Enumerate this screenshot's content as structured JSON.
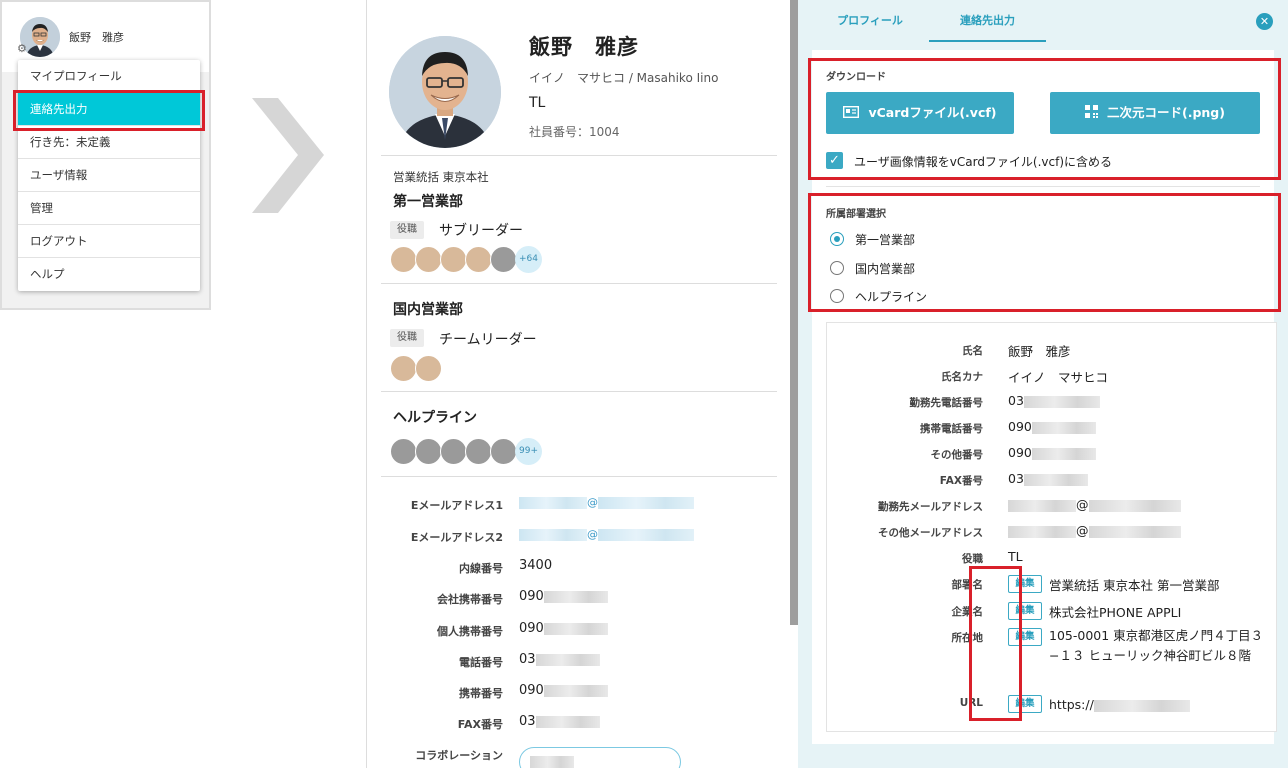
{
  "user_menu": {
    "header_name": "飯野　雅彦",
    "items": [
      {
        "label": "マイプロフィール"
      },
      {
        "label": "連絡先出力"
      },
      {
        "label": "行き先：未定義"
      },
      {
        "label": "ユーザ情報"
      },
      {
        "label": "管理"
      },
      {
        "label": "ログアウト"
      },
      {
        "label": "ヘルプ"
      }
    ],
    "active_item": "連絡先出力"
  },
  "profile": {
    "name": "飯野　雅彦",
    "kana": "イイノ　マサヒコ / Masahiko Iino",
    "title": "TL",
    "employee_no": "社員番号：1004",
    "dept_path": "営業統括 東京本社",
    "departments": [
      {
        "name": "第一営業部",
        "role_badge": "役職",
        "role": "サブリーダー",
        "more_count": "+64"
      },
      {
        "name": "国内営業部",
        "role_badge": "役職",
        "role": "チームリーダー",
        "more_count": ""
      },
      {
        "name": "ヘルプライン",
        "role_badge": "",
        "role": "",
        "more_count": "99+"
      }
    ],
    "contacts": [
      {
        "label": "Eメールアドレス1",
        "value": "@"
      },
      {
        "label": "Eメールアドレス2",
        "value": "@"
      },
      {
        "label": "内線番号",
        "value": "3400"
      },
      {
        "label": "会社携帯番号",
        "value": "090"
      },
      {
        "label": "個人携帯番号",
        "value": "090"
      },
      {
        "label": "電話番号",
        "value": "03"
      },
      {
        "label": "携帯番号",
        "value": "090"
      },
      {
        "label": "FAX番号",
        "value": "03"
      },
      {
        "label": "コラボレーション",
        "value": ""
      }
    ]
  },
  "export": {
    "tabs": [
      {
        "label": "プロフィール"
      },
      {
        "label": "連絡先出力"
      }
    ],
    "active_tab": "連絡先出力",
    "close_icon": "close-icon",
    "download": {
      "title": "ダウンロード",
      "vcard_button": "vCardファイル(.vcf)",
      "qr_button": "二次元コード(.png)",
      "include_image_label": "ユーザ画像情報をvCardファイル(.vcf)に含める",
      "include_image_checked": true
    },
    "dept_select": {
      "title": "所属部署選択",
      "options": [
        {
          "label": "第一営業部",
          "selected": true
        },
        {
          "label": "国内営業部",
          "selected": false
        },
        {
          "label": "ヘルプライン",
          "selected": false
        }
      ]
    },
    "details": [
      {
        "label": "氏名",
        "value": "飯野　雅彦"
      },
      {
        "label": "氏名カナ",
        "value": "イイノ　マサヒコ"
      },
      {
        "label": "勤務先電話番号",
        "value": "03"
      },
      {
        "label": "携帯電話番号",
        "value": "090"
      },
      {
        "label": "その他番号",
        "value": "090"
      },
      {
        "label": "FAX番号",
        "value": "03"
      },
      {
        "label": "勤務先メールアドレス",
        "value": "@"
      },
      {
        "label": "その他メールアドレス",
        "value": "@"
      },
      {
        "label": "役職",
        "value": "TL"
      },
      {
        "label": "部署名",
        "value": "営業統括 東京本社 第一営業部",
        "edit": "編集"
      },
      {
        "label": "企業名",
        "value": "株式会社PHONE APPLI",
        "edit": "編集"
      },
      {
        "label": "所在地",
        "value": "105-0001 東京都港区虎ノ門４丁目３−１３ ヒューリック神谷町ビル８階",
        "edit": "編集"
      },
      {
        "label": "URL",
        "value": "https://",
        "edit": "編集"
      }
    ]
  },
  "colors": {
    "accent": "#2a9fbd",
    "button": "#3ba9c4",
    "menu_active": "#00c8d8",
    "highlight": "#d9202a",
    "panel_bg": "#e6f3f6"
  }
}
